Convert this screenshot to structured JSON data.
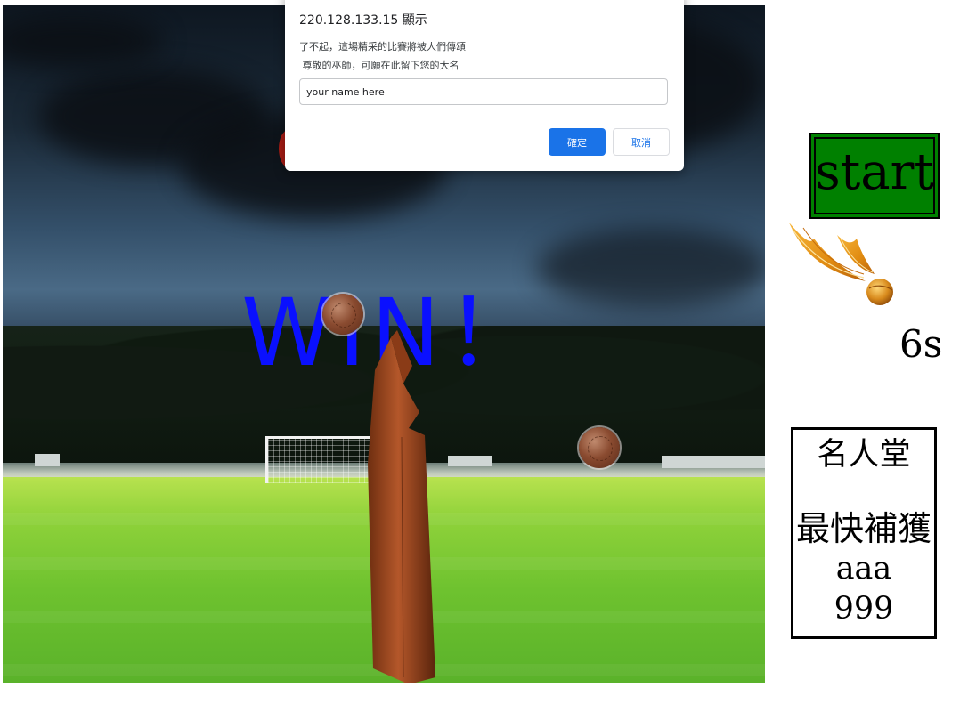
{
  "dialog": {
    "title": "220.128.133.15 顯示",
    "message": "了不起，這場精采的比賽將被人們傳頌\n 尊敬的巫師，可願在此留下您的大名",
    "input_value": "your name here",
    "ok_label": "確定",
    "cancel_label": "取消"
  },
  "game": {
    "result_text": "WIN！"
  },
  "panel": {
    "start_label": "start",
    "timer": "6s"
  },
  "hall_of_fame": {
    "title": "名人堂",
    "label": "最快補獲",
    "name": "aaa",
    "time": "999"
  },
  "colors": {
    "start_button": "#008000",
    "win_text": "#0a10ff",
    "dialog_primary": "#1a73e8"
  },
  "icons": [
    "golden-snitch-icon",
    "bludger-icon"
  ]
}
